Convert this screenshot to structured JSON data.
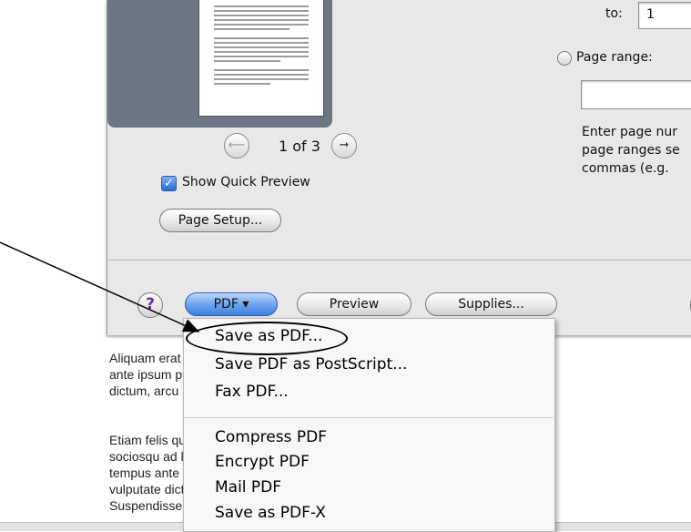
{
  "document": {
    "lines_para1": [
      "Aliquam erat volutpat. Curabitur, tincidunt varius congue. Cra",
      "ante ipsum primis in faucibus orci luctus et ultrices posuere cul",
      "dictum, arcu nibh rhoncus dictum, sem ante mollis ante, et consequat"
    ],
    "lines_para2": [
      "Etiam felis quam, tincidunt ut, rutrum imperdiet, feugiat in, lectus",
      "sociosqu ad litora torquent per conubia nostra, per inceptos hym",
      "tempus ante turpis ultrices varius lectus. Aenean nisi. Vestibulum",
      "vulputate dictum. Integer fermentum eros, eu gravida ped",
      "Suspendisse turpis pharetra nisi. Nunc at volutpat. In lob"
    ]
  },
  "print_sheet": {
    "page_indicator": "1 of 3",
    "prev_symbol": "⟵",
    "next_symbol": "➞",
    "show_quick_preview_label": "Show Quick Preview",
    "show_quick_preview_checked": true,
    "page_setup_button": "Page Setup...",
    "to_label": "to:",
    "to_value": "1",
    "page_range_label": "Page range:",
    "page_range_value": "",
    "help_lines": [
      "Enter page nur",
      "page ranges se",
      "commas (e.g."
    ],
    "help_button": "?",
    "pdf_button": "PDF ▾",
    "preview_button": "Preview",
    "supplies_button": "Supplies..."
  },
  "pdf_menu": {
    "items": [
      "Save as PDF...",
      "Save PDF as PostScript...",
      "Fax PDF...",
      "Compress PDF",
      "Encrypt PDF",
      "Mail PDF",
      "Save as PDF-X"
    ]
  },
  "colors": {
    "accent_blue": "#3f7fe0",
    "preview_well": "#6d7683",
    "sheet_bg": "#e8e8e8"
  }
}
